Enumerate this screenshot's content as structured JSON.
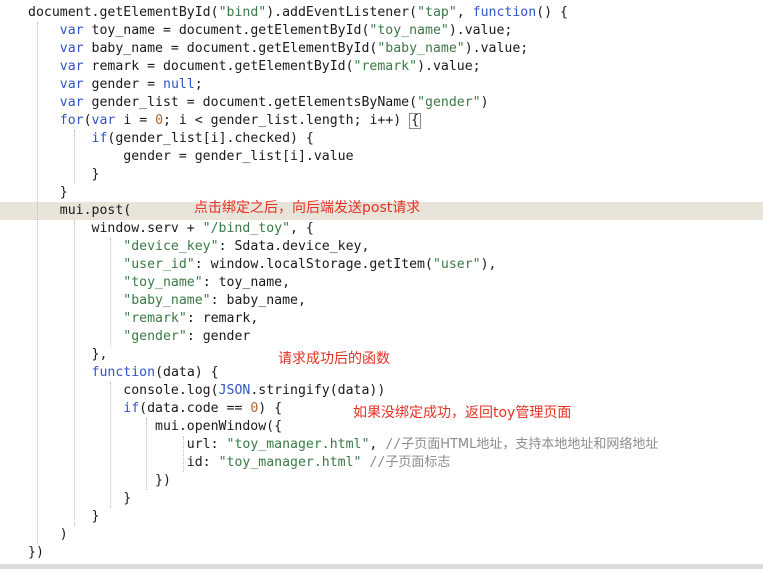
{
  "code_lines": [
    {
      "text": "document.getElementById(\"bind\").addEventListener(\"tap\", function() {"
    },
    {
      "text": "    var toy_name = document.getElementById(\"toy_name\").value;"
    },
    {
      "text": "    var baby_name = document.getElementById(\"baby_name\").value;"
    },
    {
      "text": "    var remark = document.getElementById(\"remark\").value;"
    },
    {
      "text": "    var gender = null;"
    },
    {
      "text": "    var gender_list = document.getElementsByName(\"gender\")"
    },
    {
      "text": "    for(var i = 0; i < gender_list.length; i++) {"
    },
    {
      "text": "        if(gender_list[i].checked) {"
    },
    {
      "text": "            gender = gender_list[i].value"
    },
    {
      "text": "        }"
    },
    {
      "text": "    }"
    },
    {
      "text": "    mui.post("
    },
    {
      "text": "        window.serv + \"/bind_toy\", {"
    },
    {
      "text": "            \"device_key\": Sdata.device_key,"
    },
    {
      "text": "            \"user_id\": window.localStorage.getItem(\"user\"),"
    },
    {
      "text": "            \"toy_name\": toy_name,"
    },
    {
      "text": "            \"baby_name\": baby_name,"
    },
    {
      "text": "            \"remark\": remark,"
    },
    {
      "text": "            \"gender\": gender"
    },
    {
      "text": "        },"
    },
    {
      "text": "        function(data) {"
    },
    {
      "text": "            console.log(JSON.stringify(data))"
    },
    {
      "text": "            if(data.code == 0) {"
    },
    {
      "text": "                mui.openWindow({"
    },
    {
      "text": "                    url: \"toy_manager.html\", //子页面HTML地址，支持本地地址和网络地址"
    },
    {
      "text": "                    id: \"toy_manager.html\" //子页面标志"
    },
    {
      "text": "                })"
    },
    {
      "text": "            }"
    },
    {
      "text": "        }"
    },
    {
      "text": "    )"
    },
    {
      "text": "})"
    }
  ],
  "annotations": {
    "post_note": "点击绑定之后，向后端发送post请求",
    "callback_note": "请求成功后的函数",
    "redirect_note": "如果没绑定成功，返回toy管理页面"
  },
  "highlighted_line": 11,
  "colors": {
    "keyword": "#2f55c8",
    "string": "#3a7a45",
    "number": "#b0682e",
    "comment": "#8c8c8c",
    "annotation": "#e53124",
    "current_line": "#e8e4da"
  }
}
